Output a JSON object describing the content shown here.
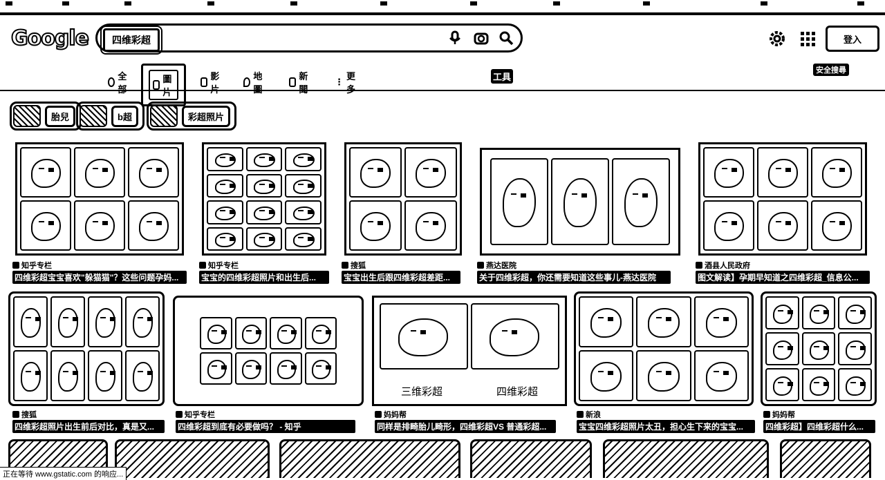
{
  "logo": "Google",
  "search": {
    "query": "四维彩超"
  },
  "header": {
    "signin_label": "登入",
    "safe_search_label": "安全搜尋"
  },
  "tabs": [
    {
      "label": "全部",
      "icon": "search-icon"
    },
    {
      "label": "圖片",
      "icon": "image-icon",
      "active": true
    },
    {
      "label": "影片",
      "icon": "video-icon"
    },
    {
      "label": "地圖",
      "icon": "map-pin-icon"
    },
    {
      "label": "新聞",
      "icon": "news-icon"
    },
    {
      "label": "更多",
      "icon": "more-vert-icon"
    }
  ],
  "tools_label": "工具",
  "chips": [
    {
      "label": "胎兒"
    },
    {
      "label": "b超"
    },
    {
      "label": "彩超照片"
    }
  ],
  "results": [
    {
      "source": "知乎专栏",
      "title": "四维彩超宝宝喜欢\"躲猫猫\"？这些问题孕妈..."
    },
    {
      "source": "知乎专栏",
      "title": "宝宝的四维彩超照片和出生后..."
    },
    {
      "source": "搜狐",
      "title": "宝宝出生后跟四维彩超差距..."
    },
    {
      "source": "燕达医院",
      "title": "关于四维彩超，你还需要知道这些事儿-燕达医院"
    },
    {
      "source": "酒县人民政府",
      "title": "图文解读】孕期早知道之四维彩超_信息公..."
    },
    {
      "source": "搜狐",
      "title": "四维彩超照片出生前后对比，真是又..."
    },
    {
      "source": "知乎专栏",
      "title": "四维彩超到底有必要做吗？ - 知乎"
    },
    {
      "source": "妈妈帮",
      "title": "同样是排畸胎儿畸形，四维彩超VS 普通彩超..."
    },
    {
      "source": "新浪",
      "title": "宝宝四维彩超照片太丑，担心生下来的宝宝..."
    },
    {
      "source": "妈妈帮",
      "title": "四维彩超】四维彩超什么..."
    }
  ],
  "image_captions": {
    "left": "三维彩超",
    "right": "四维彩超"
  },
  "status_text": "正在等待 www.gstatic.com 的响应..."
}
